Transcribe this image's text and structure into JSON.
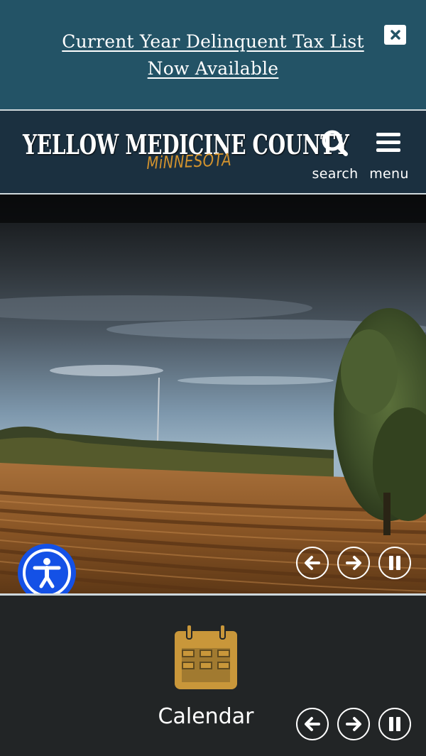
{
  "alert": {
    "text_line1": "Current Year Delinquent Tax List",
    "text_line2": "Now Available",
    "close_icon": "close-icon"
  },
  "header": {
    "logo_main": "YELLOW MEDICINE COUNTY",
    "logo_sub": "MiNNESOTA",
    "search_label": "search",
    "menu_label": "menu"
  },
  "hero": {
    "controls": [
      "prev-arrow-icon",
      "next-arrow-icon",
      "pause-icon"
    ]
  },
  "quicklinks": {
    "current_label": "Calendar",
    "icon": "calendar-icon",
    "controls": [
      "prev-arrow-icon",
      "next-arrow-icon",
      "pause-icon"
    ]
  },
  "colors": {
    "alert_bg": "#235366",
    "header_bg": "#1b3040",
    "accent_gold": "#c9973a",
    "accessibility_blue": "#1451e6",
    "footer_bg": "#222526"
  }
}
